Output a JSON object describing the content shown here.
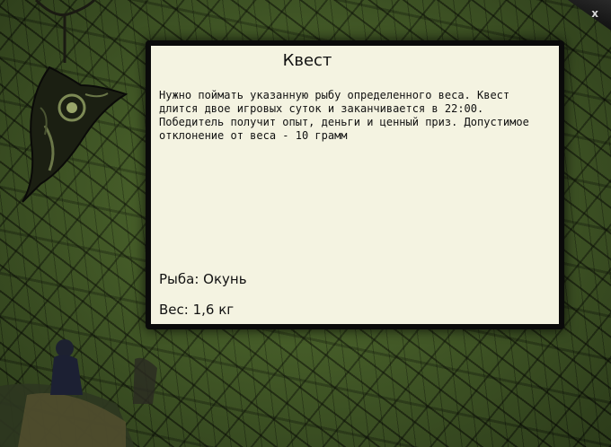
{
  "dialog": {
    "title": "Квест",
    "description": "Нужно поймать указанную рыбу определенного веса. Квест\nдлится двое игровых суток и заканчивается в 22:00.\nПобедитель получит опыт, деньги и ценный приз. Допустимое\nотклонение от веса - 10 грамм",
    "fish_label": "Рыба:",
    "fish_value": "Окунь",
    "weight_label": "Вес:",
    "weight_value": "1,6 кг"
  },
  "window": {
    "close_label": "x"
  },
  "decor": {
    "background_color": "#4f6b2f",
    "panel_color": "#f4f3e1",
    "emblem_icon": "fish-emblem-icon",
    "boat_icon": "fisherman-boat-icon"
  }
}
